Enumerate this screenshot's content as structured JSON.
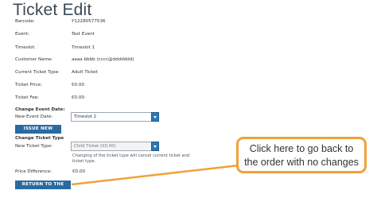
{
  "page": {
    "title": "Ticket Edit"
  },
  "details": [
    {
      "label": "Barcode:",
      "value": "Y12280577536"
    },
    {
      "label": "Event:",
      "value": "Test Event"
    },
    {
      "label": "Timeslot:",
      "value": "Timeslot 1"
    },
    {
      "label": "Customer Name:",
      "value": "aaaa bbbb (cccc@ddddddd)"
    },
    {
      "label": "Current Ticket Type:",
      "value": "Adult Ticket"
    },
    {
      "label": "Ticket Price:",
      "value": "€0.00"
    },
    {
      "label": "Ticket Fee:",
      "value": "€0.00"
    }
  ],
  "change_event": {
    "heading": "Change Event Date:",
    "label": "New Event Date:",
    "selected": "Timeslot 2",
    "button": "ISSUE NEW TICKET"
  },
  "change_type": {
    "heading": "Change Ticket Type",
    "label": "New Ticket Type:",
    "selected": "Child Ticket (€0.00)",
    "note": "Changing of the ticket type will cancel current ticket and ticket type."
  },
  "price_difference": {
    "label": "Price Difference:",
    "value": "€0.00"
  },
  "return_button": "RETURN TO THE ORDER",
  "callout": {
    "line1": "Click here to go back to",
    "line2": "the order with no changes"
  },
  "colors": {
    "button": "#2a6aa3",
    "callout_border": "#f0a13a",
    "select_arrow": "#2e78b5"
  }
}
